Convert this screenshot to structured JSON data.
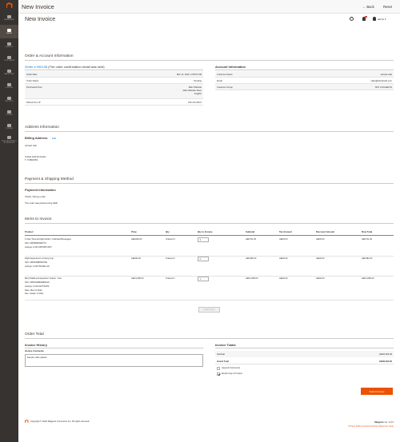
{
  "window": {
    "title": "New Invoice",
    "back_label": "Back",
    "reset_label": "Reset"
  },
  "sidebar": {
    "items": [
      {
        "label": "DASHBOARD",
        "icon": "dashboard-icon"
      },
      {
        "label": "SALES",
        "icon": "dollar-icon",
        "active": true
      },
      {
        "label": "CATALOG",
        "icon": "box-icon"
      },
      {
        "label": "CUSTOMERS",
        "icon": "person-icon"
      },
      {
        "label": "MARKETING",
        "icon": "megaphone-icon"
      },
      {
        "label": "CONTENT",
        "icon": "layout-icon"
      },
      {
        "label": "REPORTS",
        "icon": "bar-chart-icon"
      },
      {
        "label": "STORES",
        "icon": "store-icon"
      },
      {
        "label": "SYSTEM",
        "icon": "gear-icon"
      },
      {
        "label": "FIND PARTNERS & EXTENSIONS",
        "icon": "cube-icon"
      }
    ]
  },
  "header": {
    "page_title": "New Invoice",
    "notification_count": "1",
    "username": "admin"
  },
  "order_account": {
    "title": "Order & Account Information",
    "order_link": "Order # 000138",
    "order_note": "(The order confirmation email was sent)",
    "order_rows": [
      {
        "label": "Order Date",
        "value": "Mar 13, 2020, 2:59:51 PM"
      },
      {
        "label": "Order Status",
        "value": "Pending"
      },
      {
        "label": "Purchased From",
        "value": "Main Website"
      },
      {
        "label": "Placed from IP",
        "value": "156.114.236.0"
      }
    ],
    "purchased_from_extra": [
      "Main Website Store",
      "English"
    ],
    "account_title": "Account Information",
    "account_rows": [
      {
        "label": "Customer Name",
        "value": "sample sale"
      },
      {
        "label": "Email",
        "value": "sales@abcdmobi.com"
      },
      {
        "label": "Customer Group",
        "value": "NOT LOGGED IN"
      }
    ]
  },
  "address": {
    "title": "Address Information",
    "billing_title": "Billing Address",
    "edit_label": "Edit",
    "lines": [
      "sample sale",
      ",",
      "",
      "United Arab Emirates",
      "T: 0 9822252"
    ]
  },
  "payment": {
    "title": "Payment & Shipping Method",
    "sub_title": "Payment Information",
    "method": "Check / Money order",
    "note": "The order was placed using AED."
  },
  "items": {
    "title": "Items to Invoice",
    "columns": [
      "Product",
      "Price",
      "Qty",
      "Qty to Invoice",
      "Subtotal",
      "Tax Amount",
      "Discount Amount",
      "Row Total"
    ],
    "rows": [
      {
        "name": "5-Year Thermal Night buffer / Unlimited Beverages",
        "sku": "SKU: MP2866F806770",
        "lines": [
          "Listings: LOW OPPORTUNIT"
        ],
        "price": "AED229.00",
        "ordered": "Ordered 3",
        "qty": "3",
        "subtotal": "AED711.00",
        "tax": "AED0.00",
        "discount": "AED0.00",
        "row_total": "AED711.00"
      },
      {
        "name": "Flight Experience in Flying Cup",
        "sku": "SKU: MP2916BRROVIE",
        "lines": [
          "Listings: LOW TRAVELLIS"
        ],
        "price": "AED90.00",
        "ordered": "Ordered 2",
        "qty": "2",
        "subtotal": "AED180.00",
        "tax": "AED0.00",
        "discount": "AED0.00",
        "row_total": "AED180.00"
      },
      {
        "name": "Burj Khalifa and Aquarium Tickets - Test",
        "sku": "SKU: MP2911BEF8E6A1S",
        "lines": [
          "Listings: LOOC EFTSOPS",
          "Date: Mar 13 2020",
          "Pax: 1Adult, 0 Child"
        ],
        "price": "AED1,085.00",
        "ordered": "Ordered 1",
        "qty": "1",
        "subtotal": "AED1,085.00",
        "tax": "AED0.00",
        "discount": "AED0.00",
        "row_total": "AED1,085.00"
      }
    ],
    "update_label": "Update Qty's"
  },
  "order_total": {
    "title": "Order Total",
    "history_title": "Invoice History",
    "comments_label": "Invoice Comments",
    "comment_value": "Sample order placed",
    "totals_title": "Invoice Totals",
    "subtotal_label": "Subtotal",
    "subtotal_value": "AED2,000.00",
    "grand_label": "Grand Total",
    "grand_value": "AED2,000.00",
    "append_label": "Append Comments",
    "email_label": "Email Copy of Invoice",
    "submit_label": "Submit Invoice"
  },
  "footer": {
    "copyright": "Copyright © 2020 Magento Commerce Inc. All rights reserved.",
    "brand": "Magento",
    "version": "ver. 2.3.3",
    "links": [
      "Privacy Policy",
      "Account Activity",
      "Report an Issue"
    ]
  }
}
